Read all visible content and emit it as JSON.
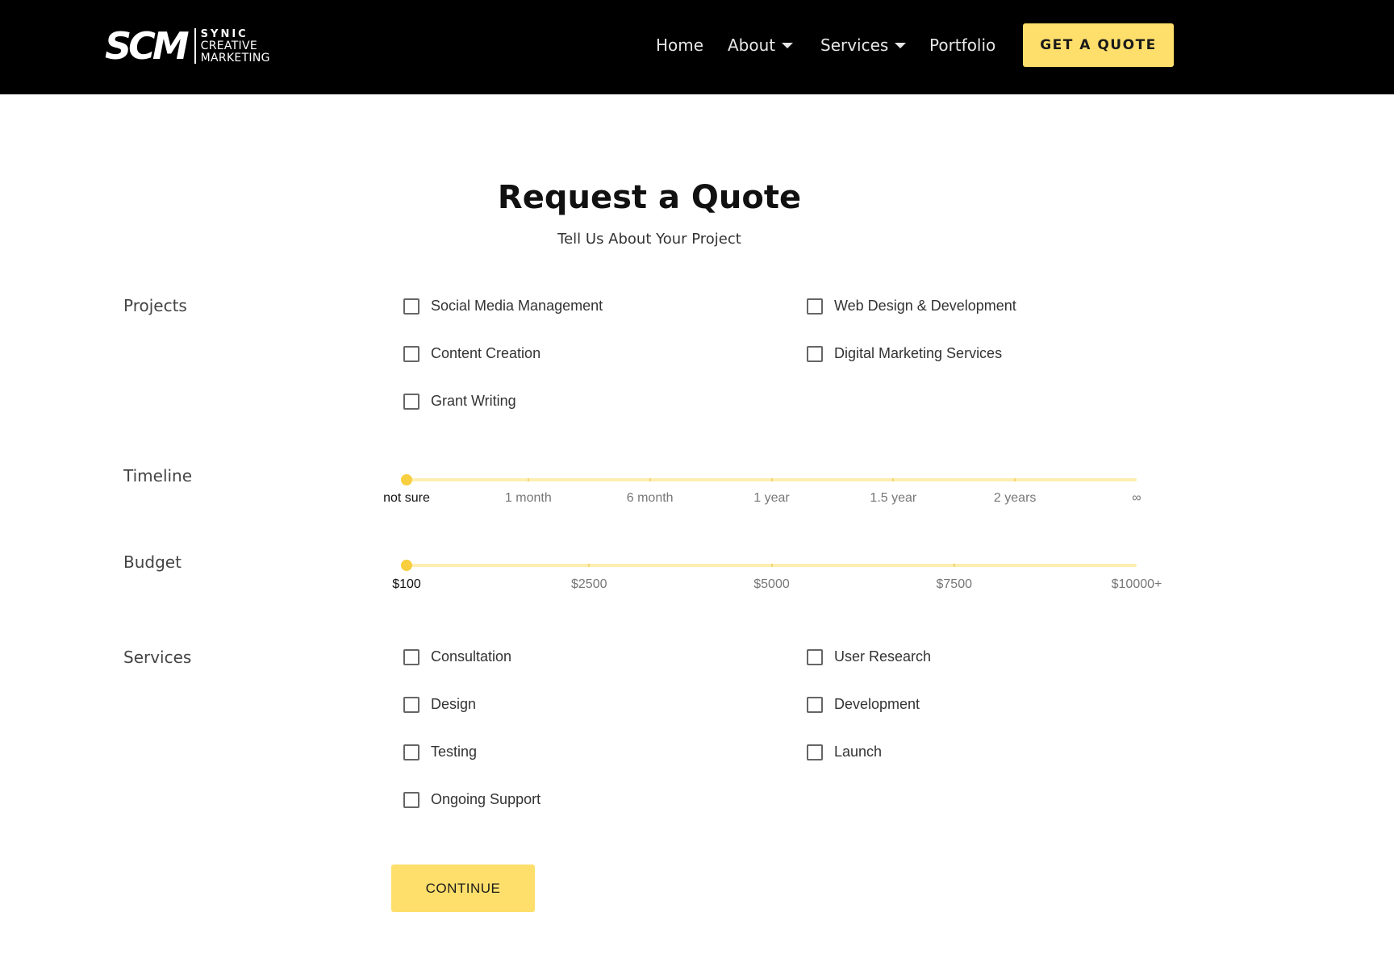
{
  "header": {
    "logo": {
      "mark": "SCM",
      "line1": "SYNIC",
      "line2": "CREATIVE",
      "line3": "MARKETING"
    },
    "nav": [
      {
        "label": "Home",
        "has_dropdown": false
      },
      {
        "label": "About",
        "has_dropdown": true
      },
      {
        "label": "Services",
        "has_dropdown": true
      },
      {
        "label": "Portfolio",
        "has_dropdown": false
      }
    ],
    "cta_label": "GET A QUOTE"
  },
  "form": {
    "title": "Request a Quote",
    "subtitle": "Tell Us About Your Project",
    "projects": {
      "label": "Projects",
      "options": [
        {
          "label": "Social Media Management",
          "checked": false
        },
        {
          "label": "Web Design & Development",
          "checked": false
        },
        {
          "label": "Content Creation",
          "checked": false
        },
        {
          "label": "Digital Marketing Services",
          "checked": false
        },
        {
          "label": "Grant Writing",
          "checked": false
        }
      ]
    },
    "timeline": {
      "label": "Timeline",
      "steps": [
        "not sure",
        "1 month",
        "6 month",
        "1 year",
        "1.5 year",
        "2 years",
        "∞"
      ],
      "selected": "not sure"
    },
    "budget": {
      "label": "Budget",
      "steps": [
        "$100",
        "$2500",
        "$5000",
        "$7500",
        "$10000+"
      ],
      "selected": "$100"
    },
    "services": {
      "label": "Services",
      "options": [
        {
          "label": "Consultation",
          "checked": false
        },
        {
          "label": "User Research",
          "checked": false
        },
        {
          "label": "Design",
          "checked": false
        },
        {
          "label": "Development",
          "checked": false
        },
        {
          "label": "Testing",
          "checked": false
        },
        {
          "label": "Launch",
          "checked": false
        },
        {
          "label": "Ongoing Support",
          "checked": false
        }
      ]
    },
    "continue_label": "CONTINUE"
  },
  "colors": {
    "accent": "#fedf6b",
    "header_bg": "#000000",
    "slider_track": "#fdeeb1",
    "slider_thumb": "#f7cf3f"
  }
}
